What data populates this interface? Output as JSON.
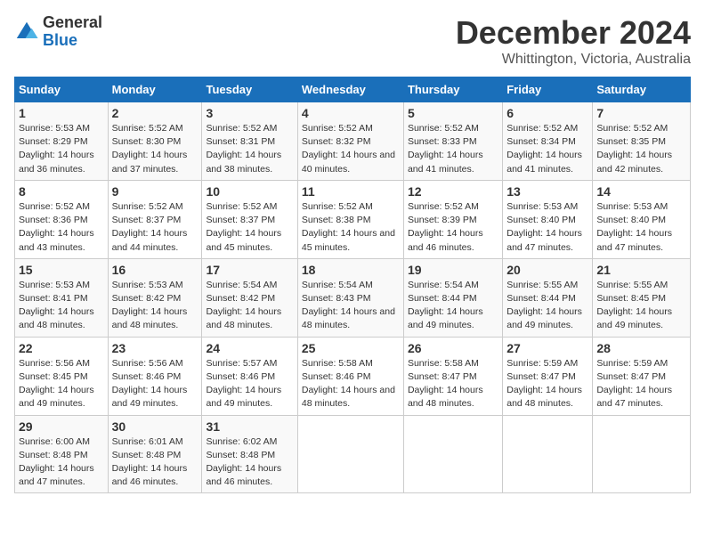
{
  "logo": {
    "general": "General",
    "blue": "Blue"
  },
  "title": "December 2024",
  "subtitle": "Whittington, Victoria, Australia",
  "days_header": [
    "Sunday",
    "Monday",
    "Tuesday",
    "Wednesday",
    "Thursday",
    "Friday",
    "Saturday"
  ],
  "weeks": [
    [
      {
        "day": "1",
        "sunrise": "5:53 AM",
        "sunset": "8:29 PM",
        "daylight": "14 hours and 36 minutes."
      },
      {
        "day": "2",
        "sunrise": "5:52 AM",
        "sunset": "8:30 PM",
        "daylight": "14 hours and 37 minutes."
      },
      {
        "day": "3",
        "sunrise": "5:52 AM",
        "sunset": "8:31 PM",
        "daylight": "14 hours and 38 minutes."
      },
      {
        "day": "4",
        "sunrise": "5:52 AM",
        "sunset": "8:32 PM",
        "daylight": "14 hours and 40 minutes."
      },
      {
        "day": "5",
        "sunrise": "5:52 AM",
        "sunset": "8:33 PM",
        "daylight": "14 hours and 41 minutes."
      },
      {
        "day": "6",
        "sunrise": "5:52 AM",
        "sunset": "8:34 PM",
        "daylight": "14 hours and 41 minutes."
      },
      {
        "day": "7",
        "sunrise": "5:52 AM",
        "sunset": "8:35 PM",
        "daylight": "14 hours and 42 minutes."
      }
    ],
    [
      {
        "day": "8",
        "sunrise": "5:52 AM",
        "sunset": "8:36 PM",
        "daylight": "14 hours and 43 minutes."
      },
      {
        "day": "9",
        "sunrise": "5:52 AM",
        "sunset": "8:37 PM",
        "daylight": "14 hours and 44 minutes."
      },
      {
        "day": "10",
        "sunrise": "5:52 AM",
        "sunset": "8:37 PM",
        "daylight": "14 hours and 45 minutes."
      },
      {
        "day": "11",
        "sunrise": "5:52 AM",
        "sunset": "8:38 PM",
        "daylight": "14 hours and 45 minutes."
      },
      {
        "day": "12",
        "sunrise": "5:52 AM",
        "sunset": "8:39 PM",
        "daylight": "14 hours and 46 minutes."
      },
      {
        "day": "13",
        "sunrise": "5:53 AM",
        "sunset": "8:40 PM",
        "daylight": "14 hours and 47 minutes."
      },
      {
        "day": "14",
        "sunrise": "5:53 AM",
        "sunset": "8:40 PM",
        "daylight": "14 hours and 47 minutes."
      }
    ],
    [
      {
        "day": "15",
        "sunrise": "5:53 AM",
        "sunset": "8:41 PM",
        "daylight": "14 hours and 48 minutes."
      },
      {
        "day": "16",
        "sunrise": "5:53 AM",
        "sunset": "8:42 PM",
        "daylight": "14 hours and 48 minutes."
      },
      {
        "day": "17",
        "sunrise": "5:54 AM",
        "sunset": "8:42 PM",
        "daylight": "14 hours and 48 minutes."
      },
      {
        "day": "18",
        "sunrise": "5:54 AM",
        "sunset": "8:43 PM",
        "daylight": "14 hours and 48 minutes."
      },
      {
        "day": "19",
        "sunrise": "5:54 AM",
        "sunset": "8:44 PM",
        "daylight": "14 hours and 49 minutes."
      },
      {
        "day": "20",
        "sunrise": "5:55 AM",
        "sunset": "8:44 PM",
        "daylight": "14 hours and 49 minutes."
      },
      {
        "day": "21",
        "sunrise": "5:55 AM",
        "sunset": "8:45 PM",
        "daylight": "14 hours and 49 minutes."
      }
    ],
    [
      {
        "day": "22",
        "sunrise": "5:56 AM",
        "sunset": "8:45 PM",
        "daylight": "14 hours and 49 minutes."
      },
      {
        "day": "23",
        "sunrise": "5:56 AM",
        "sunset": "8:46 PM",
        "daylight": "14 hours and 49 minutes."
      },
      {
        "day": "24",
        "sunrise": "5:57 AM",
        "sunset": "8:46 PM",
        "daylight": "14 hours and 49 minutes."
      },
      {
        "day": "25",
        "sunrise": "5:58 AM",
        "sunset": "8:46 PM",
        "daylight": "14 hours and 48 minutes."
      },
      {
        "day": "26",
        "sunrise": "5:58 AM",
        "sunset": "8:47 PM",
        "daylight": "14 hours and 48 minutes."
      },
      {
        "day": "27",
        "sunrise": "5:59 AM",
        "sunset": "8:47 PM",
        "daylight": "14 hours and 48 minutes."
      },
      {
        "day": "28",
        "sunrise": "5:59 AM",
        "sunset": "8:47 PM",
        "daylight": "14 hours and 47 minutes."
      }
    ],
    [
      {
        "day": "29",
        "sunrise": "6:00 AM",
        "sunset": "8:48 PM",
        "daylight": "14 hours and 47 minutes."
      },
      {
        "day": "30",
        "sunrise": "6:01 AM",
        "sunset": "8:48 PM",
        "daylight": "14 hours and 46 minutes."
      },
      {
        "day": "31",
        "sunrise": "6:02 AM",
        "sunset": "8:48 PM",
        "daylight": "14 hours and 46 minutes."
      },
      null,
      null,
      null,
      null
    ]
  ]
}
